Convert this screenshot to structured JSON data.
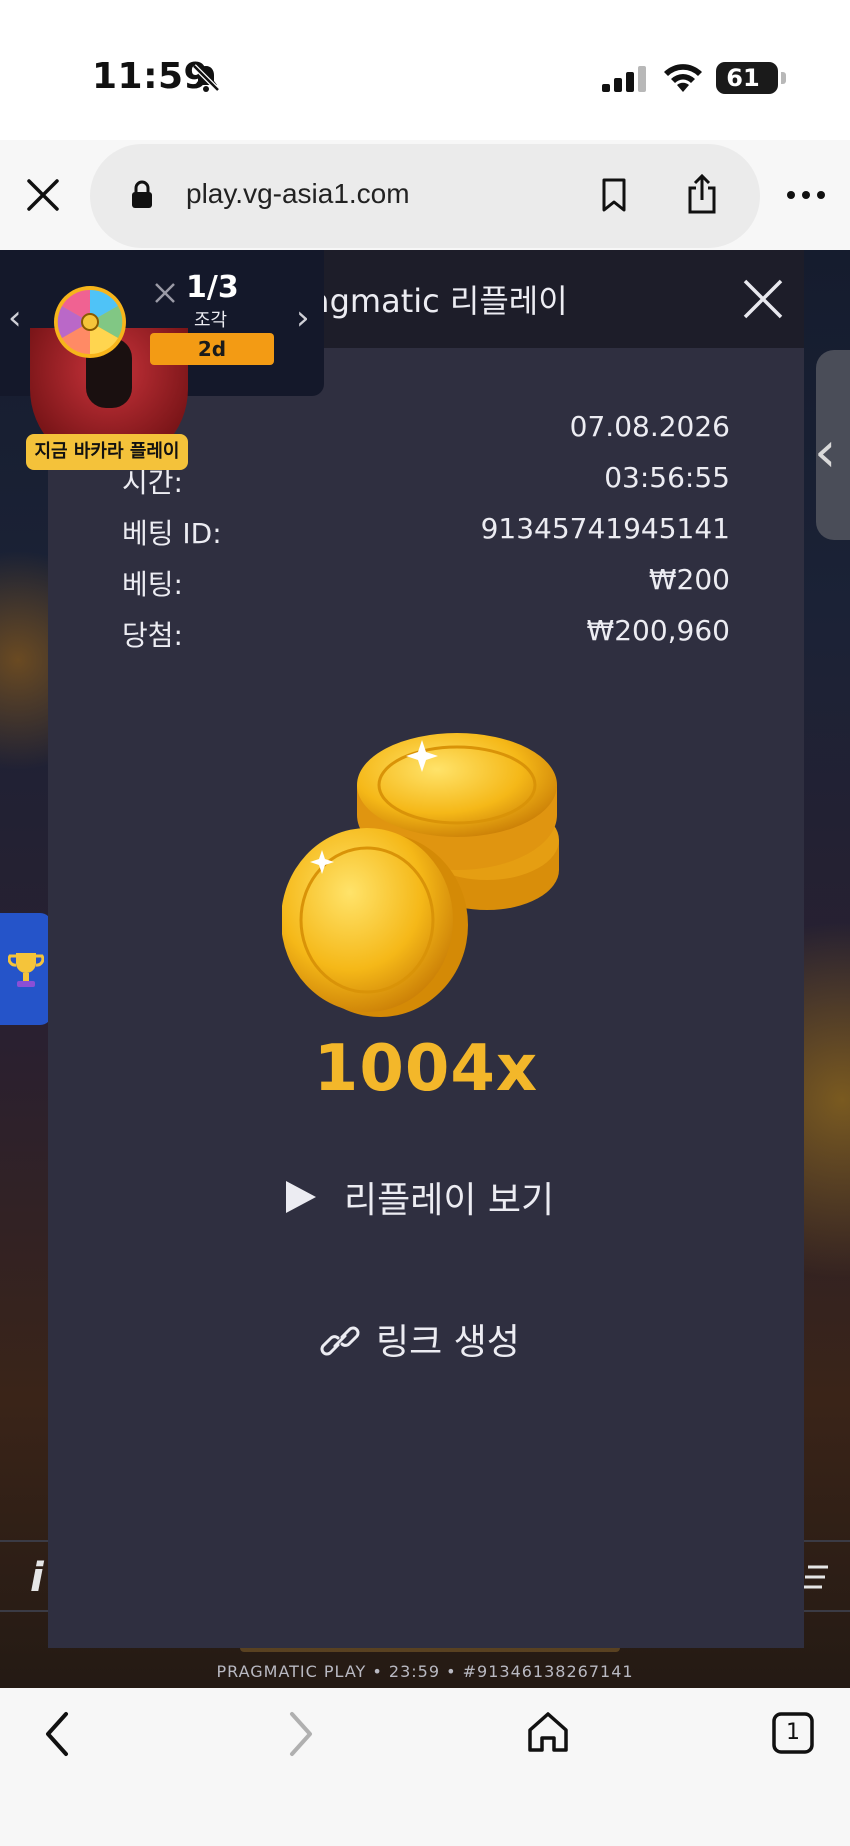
{
  "status_bar": {
    "time": "11:59",
    "battery": "61"
  },
  "browser": {
    "url": "play.vg-asia1.com"
  },
  "promo": {
    "count": "1/3",
    "unit": "조각",
    "days": "2d",
    "cta": "지금 바카라 플레이"
  },
  "modal": {
    "title": "agmatic 리플레이",
    "rows": [
      {
        "label": ":",
        "value": "07.08.2026"
      },
      {
        "label": "시간:",
        "value": "03:56:55"
      },
      {
        "label": "베팅 ID:",
        "value": "91345741945141"
      },
      {
        "label": "베팅:",
        "value": "₩200"
      },
      {
        "label": "당첨:",
        "value": "₩200,960"
      }
    ],
    "multiplier": "1004x",
    "replay_label": "리플레이 보기",
    "link_label": "링크 생성"
  },
  "background": {
    "left_letter": "i",
    "footer": "PRAGMATIC PLAY • 23:59 • #91346138267141"
  },
  "toolbar": {
    "tabs_count": "1"
  },
  "colors": {
    "modal_bg": "#2f2f40",
    "modal_header": "#1d1d29",
    "multiplier": "#f3b72a",
    "promo_badge": "#f39b14",
    "trophy_tab": "#2554c9"
  }
}
